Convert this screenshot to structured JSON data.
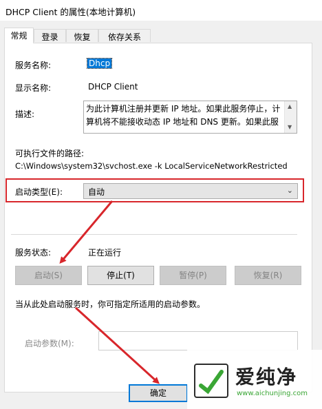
{
  "window": {
    "title": "DHCP Client 的属性(本地计算机)"
  },
  "tabs": [
    {
      "label": "常规"
    },
    {
      "label": "登录"
    },
    {
      "label": "恢复"
    },
    {
      "label": "依存关系"
    }
  ],
  "general": {
    "service_name_label": "服务名称:",
    "service_name_value": "Dhcp",
    "display_name_label": "显示名称:",
    "display_name_value": "DHCP Client",
    "description_label": "描述:",
    "description_value": "为此计算机注册并更新 IP 地址。如果此服务停止，计算机将不能接收动态 IP 地址和 DNS 更新。如果此服",
    "path_label": "可执行文件的路径:",
    "path_value": "C:\\Windows\\system32\\svchost.exe -k LocalServiceNetworkRestricted",
    "startup_type_label": "启动类型(E):",
    "startup_type_value": "自动",
    "status_label": "服务状态:",
    "status_value": "正在运行",
    "buttons": {
      "start": "启动(S)",
      "stop": "停止(T)",
      "pause": "暂停(P)",
      "resume": "恢复(R)"
    },
    "hint": "当从此处启动服务时，你可指定所适用的启动参数。",
    "param_label": "启动参数(M):",
    "param_value": ""
  },
  "dialog": {
    "ok_label": "确定"
  },
  "watermark": {
    "text": "爱纯净",
    "url": "www.aichunjing.com"
  },
  "colors": {
    "highlight": "#0078d7",
    "annotation_red": "#d8262b",
    "watermark_green": "#3aa635"
  }
}
